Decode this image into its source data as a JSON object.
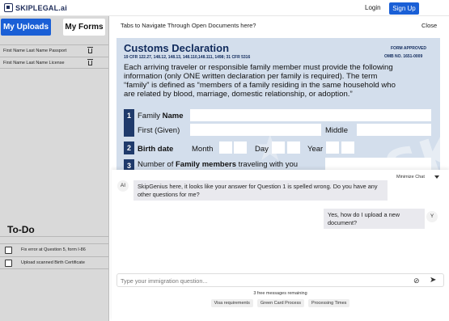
{
  "app": {
    "logo_text": "SKIPLEGAL.ai"
  },
  "header": {
    "login_label": "Login",
    "signup_label": "Sign Up"
  },
  "sidebar": {
    "tabs": [
      {
        "label": "My Uploads"
      },
      {
        "label": "My Forms"
      }
    ],
    "uploads": [
      {
        "label": "First Name Last Name Passport"
      },
      {
        "label": "First Name Last Name License"
      }
    ],
    "todo_title": "To-Do",
    "todo_items": [
      {
        "label": "Fix error at Question 5, form I-86",
        "checked": false
      },
      {
        "label": "Upload scanned Birth Certificate",
        "checked": false
      }
    ]
  },
  "main": {
    "header_text": "Tabs to Navigate Through Open Documents here?",
    "close_label": "Close"
  },
  "document": {
    "title": "Customs Declaration",
    "subtitle": "19 CFR 122.27, 148.12, 148.13, 148.110,148.111, 1498; 31 CFR 5316",
    "form_approved": "FORM APPROVED",
    "omb": "OMB NO. 1651-0009",
    "intro_lines": [
      "Each arriving traveler or responsible family member must provide the following",
      "information (only ONE written declaration per family is required). The term",
      "“family” is defined as “members of a family residing in the same household who",
      "are related by blood, marriage, domestic relationship, or adoption.”"
    ],
    "q1": {
      "number": "1",
      "label_prefix": "Family ",
      "label_bold": "Name",
      "first_label": "First (Given)",
      "middle_label": "Middle"
    },
    "q2": {
      "number": "2",
      "label": "Birth date",
      "month_label": "Month",
      "day_label": "Day",
      "year_label": "Year"
    },
    "q3": {
      "number": "3",
      "label_prefix": "Number of ",
      "label_bold": "Family members",
      "label_suffix": " traveling with you"
    },
    "watermark": "SKIP"
  },
  "chat": {
    "minimize_label": "Minimize Chat",
    "messages": [
      {
        "sender": "AI",
        "avatar": "AI",
        "text": "SkipGenius here, it looks like your answer for Question 1 is spelled wrong. Do you have any other questions for me?"
      },
      {
        "sender": "user",
        "avatar": "Y",
        "text": "Yes, how do I upload a new document?"
      }
    ],
    "input_placeholder": "Type your immigration question...",
    "remaining_text": "3 free messages remaining",
    "suggestions": [
      "Visa requirements",
      "Green Card Process",
      "Processing Times"
    ]
  },
  "colors": {
    "brand_blue": "#1a5fd6",
    "doc_background": "#d3deec",
    "doc_navy": "#102a5c"
  }
}
